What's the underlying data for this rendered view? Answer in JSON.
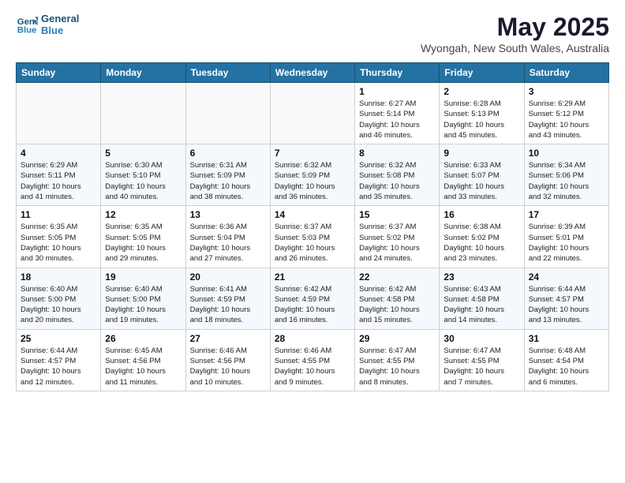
{
  "header": {
    "logo_line1": "General",
    "logo_line2": "Blue",
    "title": "May 2025",
    "subtitle": "Wyongah, New South Wales, Australia"
  },
  "weekdays": [
    "Sunday",
    "Monday",
    "Tuesday",
    "Wednesday",
    "Thursday",
    "Friday",
    "Saturday"
  ],
  "weeks": [
    [
      {
        "day": "",
        "info": ""
      },
      {
        "day": "",
        "info": ""
      },
      {
        "day": "",
        "info": ""
      },
      {
        "day": "",
        "info": ""
      },
      {
        "day": "1",
        "info": "Sunrise: 6:27 AM\nSunset: 5:14 PM\nDaylight: 10 hours\nand 46 minutes."
      },
      {
        "day": "2",
        "info": "Sunrise: 6:28 AM\nSunset: 5:13 PM\nDaylight: 10 hours\nand 45 minutes."
      },
      {
        "day": "3",
        "info": "Sunrise: 6:29 AM\nSunset: 5:12 PM\nDaylight: 10 hours\nand 43 minutes."
      }
    ],
    [
      {
        "day": "4",
        "info": "Sunrise: 6:29 AM\nSunset: 5:11 PM\nDaylight: 10 hours\nand 41 minutes."
      },
      {
        "day": "5",
        "info": "Sunrise: 6:30 AM\nSunset: 5:10 PM\nDaylight: 10 hours\nand 40 minutes."
      },
      {
        "day": "6",
        "info": "Sunrise: 6:31 AM\nSunset: 5:09 PM\nDaylight: 10 hours\nand 38 minutes."
      },
      {
        "day": "7",
        "info": "Sunrise: 6:32 AM\nSunset: 5:09 PM\nDaylight: 10 hours\nand 36 minutes."
      },
      {
        "day": "8",
        "info": "Sunrise: 6:32 AM\nSunset: 5:08 PM\nDaylight: 10 hours\nand 35 minutes."
      },
      {
        "day": "9",
        "info": "Sunrise: 6:33 AM\nSunset: 5:07 PM\nDaylight: 10 hours\nand 33 minutes."
      },
      {
        "day": "10",
        "info": "Sunrise: 6:34 AM\nSunset: 5:06 PM\nDaylight: 10 hours\nand 32 minutes."
      }
    ],
    [
      {
        "day": "11",
        "info": "Sunrise: 6:35 AM\nSunset: 5:05 PM\nDaylight: 10 hours\nand 30 minutes."
      },
      {
        "day": "12",
        "info": "Sunrise: 6:35 AM\nSunset: 5:05 PM\nDaylight: 10 hours\nand 29 minutes."
      },
      {
        "day": "13",
        "info": "Sunrise: 6:36 AM\nSunset: 5:04 PM\nDaylight: 10 hours\nand 27 minutes."
      },
      {
        "day": "14",
        "info": "Sunrise: 6:37 AM\nSunset: 5:03 PM\nDaylight: 10 hours\nand 26 minutes."
      },
      {
        "day": "15",
        "info": "Sunrise: 6:37 AM\nSunset: 5:02 PM\nDaylight: 10 hours\nand 24 minutes."
      },
      {
        "day": "16",
        "info": "Sunrise: 6:38 AM\nSunset: 5:02 PM\nDaylight: 10 hours\nand 23 minutes."
      },
      {
        "day": "17",
        "info": "Sunrise: 6:39 AM\nSunset: 5:01 PM\nDaylight: 10 hours\nand 22 minutes."
      }
    ],
    [
      {
        "day": "18",
        "info": "Sunrise: 6:40 AM\nSunset: 5:00 PM\nDaylight: 10 hours\nand 20 minutes."
      },
      {
        "day": "19",
        "info": "Sunrise: 6:40 AM\nSunset: 5:00 PM\nDaylight: 10 hours\nand 19 minutes."
      },
      {
        "day": "20",
        "info": "Sunrise: 6:41 AM\nSunset: 4:59 PM\nDaylight: 10 hours\nand 18 minutes."
      },
      {
        "day": "21",
        "info": "Sunrise: 6:42 AM\nSunset: 4:59 PM\nDaylight: 10 hours\nand 16 minutes."
      },
      {
        "day": "22",
        "info": "Sunrise: 6:42 AM\nSunset: 4:58 PM\nDaylight: 10 hours\nand 15 minutes."
      },
      {
        "day": "23",
        "info": "Sunrise: 6:43 AM\nSunset: 4:58 PM\nDaylight: 10 hours\nand 14 minutes."
      },
      {
        "day": "24",
        "info": "Sunrise: 6:44 AM\nSunset: 4:57 PM\nDaylight: 10 hours\nand 13 minutes."
      }
    ],
    [
      {
        "day": "25",
        "info": "Sunrise: 6:44 AM\nSunset: 4:57 PM\nDaylight: 10 hours\nand 12 minutes."
      },
      {
        "day": "26",
        "info": "Sunrise: 6:45 AM\nSunset: 4:56 PM\nDaylight: 10 hours\nand 11 minutes."
      },
      {
        "day": "27",
        "info": "Sunrise: 6:46 AM\nSunset: 4:56 PM\nDaylight: 10 hours\nand 10 minutes."
      },
      {
        "day": "28",
        "info": "Sunrise: 6:46 AM\nSunset: 4:55 PM\nDaylight: 10 hours\nand 9 minutes."
      },
      {
        "day": "29",
        "info": "Sunrise: 6:47 AM\nSunset: 4:55 PM\nDaylight: 10 hours\nand 8 minutes."
      },
      {
        "day": "30",
        "info": "Sunrise: 6:47 AM\nSunset: 4:55 PM\nDaylight: 10 hours\nand 7 minutes."
      },
      {
        "day": "31",
        "info": "Sunrise: 6:48 AM\nSunset: 4:54 PM\nDaylight: 10 hours\nand 6 minutes."
      }
    ]
  ]
}
